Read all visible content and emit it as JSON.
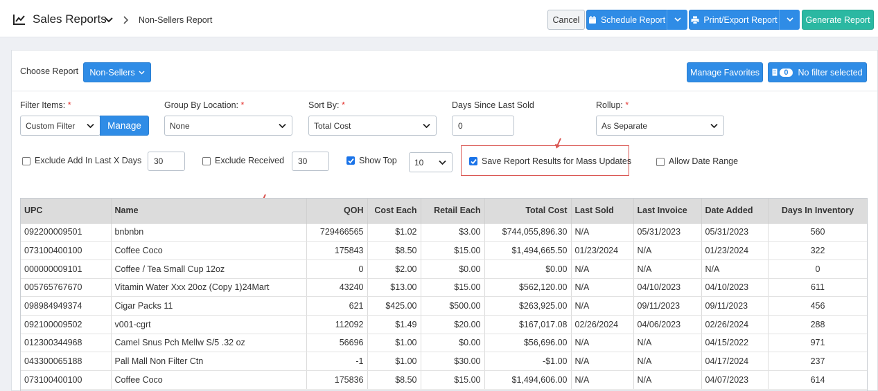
{
  "header": {
    "title": "Sales Reports",
    "breadcrumb": "Non-Sellers Report",
    "buttons": {
      "cancel": "Cancel",
      "schedule": "Schedule Report",
      "print_export": "Print/Export Report",
      "generate": "Generate Report"
    }
  },
  "report_bar": {
    "choose_label": "Choose Report",
    "selected_report": "Non-Sellers",
    "manage_favorites": "Manage Favorites",
    "filter_count": "0",
    "filter_status": "No filter selected"
  },
  "filters": {
    "filter_items": {
      "label": "Filter Items:",
      "value": "Custom Filter",
      "manage": "Manage"
    },
    "group_by_location": {
      "label": "Group By Location:",
      "value": "None"
    },
    "sort_by": {
      "label": "Sort By:",
      "value": "Total Cost"
    },
    "days_since_last_sold": {
      "label": "Days Since Last Sold",
      "value": "0"
    },
    "rollup": {
      "label": "Rollup:",
      "value": "As Separate"
    },
    "required_mark": "*"
  },
  "options": {
    "exclude_add": {
      "label": "Exclude Add In Last X Days",
      "checked": false,
      "value": "30"
    },
    "exclude_received": {
      "label": "Exclude Received",
      "checked": false,
      "value": "30"
    },
    "show_top": {
      "label": "Show Top",
      "checked": true,
      "value": "10"
    },
    "save_results": {
      "label": "Save Report Results for Mass Updates",
      "checked": true
    },
    "allow_date_range": {
      "label": "Allow Date Range",
      "checked": false
    }
  },
  "table": {
    "columns": [
      "UPC",
      "Name",
      "QOH",
      "Cost Each",
      "Retail Each",
      "Total Cost",
      "Last Sold",
      "Last Invoice",
      "Date Added",
      "Days In Inventory"
    ],
    "rows": [
      [
        "092200009501",
        "bnbnbn",
        "729466565",
        "$1.02",
        "$3.00",
        "$744,055,896.30",
        "N/A",
        "05/31/2023",
        "05/31/2023",
        "560"
      ],
      [
        "073100400100",
        "Coffee Coco",
        "175843",
        "$8.50",
        "$15.00",
        "$1,494,665.50",
        "01/23/2024",
        "N/A",
        "01/23/2024",
        "322"
      ],
      [
        "000000009101",
        "Coffee / Tea Small Cup 12oz",
        "0",
        "$2.00",
        "$0.00",
        "$0.00",
        "N/A",
        "N/A",
        "N/A",
        "0"
      ],
      [
        "005765767670",
        "Vitamin Water Xxx 20oz (Copy 1)24Mart",
        "43240",
        "$13.00",
        "$15.00",
        "$562,120.00",
        "N/A",
        "04/10/2023",
        "04/10/2023",
        "611"
      ],
      [
        "098984949374",
        "Cigar Packs 11",
        "621",
        "$425.00",
        "$500.00",
        "$263,925.00",
        "N/A",
        "09/11/2023",
        "09/11/2023",
        "456"
      ],
      [
        "092100009502",
        "v001-cgrt",
        "112092",
        "$1.49",
        "$20.00",
        "$167,017.08",
        "02/26/2024",
        "04/06/2023",
        "02/26/2024",
        "288"
      ],
      [
        "012300344968",
        "Camel Snus Pch Mellw S/5 .32 oz",
        "56696",
        "$1.00",
        "$0.00",
        "$56,696.00",
        "N/A",
        "N/A",
        "04/15/2022",
        "971"
      ],
      [
        "043300065188",
        "Pall Mall Non Filter Ctn",
        "-1",
        "$1.00",
        "$30.00",
        "-$1.00",
        "N/A",
        "N/A",
        "04/17/2024",
        "237"
      ],
      [
        "073100400100",
        "Coffee Coco",
        "175836",
        "$8.50",
        "$15.00",
        "$1,494,606.00",
        "N/A",
        "N/A",
        "04/07/2023",
        "614"
      ]
    ]
  },
  "colors": {
    "primary": "#2f8ce6",
    "success": "#2bb8a2",
    "required": "#e53935",
    "highlight": "#d9534f"
  }
}
